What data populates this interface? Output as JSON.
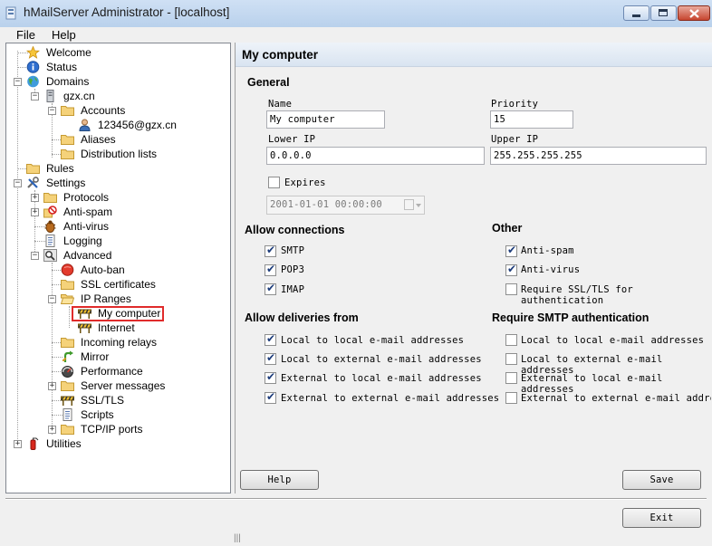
{
  "window": {
    "title": "hMailServer Administrator - [localhost]"
  },
  "menu": {
    "file": "File",
    "help": "Help"
  },
  "tree": {
    "welcome": "Welcome",
    "status": "Status",
    "domains": "Domains",
    "domain": "gzx.cn",
    "accounts": "Accounts",
    "account": "123456@gzx.cn",
    "aliases": "Aliases",
    "distribution_lists": "Distribution lists",
    "rules": "Rules",
    "settings": "Settings",
    "protocols": "Protocols",
    "anti_spam": "Anti-spam",
    "anti_virus": "Anti-virus",
    "logging": "Logging",
    "advanced": "Advanced",
    "auto_ban": "Auto-ban",
    "ssl_certificates": "SSL certificates",
    "ip_ranges": "IP Ranges",
    "my_computer": "My computer",
    "internet": "Internet",
    "incoming_relays": "Incoming relays",
    "mirror": "Mirror",
    "performance": "Performance",
    "server_messages": "Server messages",
    "ssl_tls": "SSL/TLS",
    "scripts": "Scripts",
    "tcpip_ports": "TCP/IP ports",
    "utilities": "Utilities"
  },
  "panel": {
    "title": "My computer",
    "general": "General",
    "name_label": "Name",
    "name_value": "My computer",
    "priority_label": "Priority",
    "priority_value": "15",
    "lower_ip_label": "Lower IP",
    "lower_ip_value": "0.0.0.0",
    "upper_ip_label": "Upper IP",
    "upper_ip_value": "255.255.255.255",
    "expires_label": "Expires",
    "expires_value": "2001-01-01 00:00:00",
    "allow_connections": "Allow connections",
    "smtp": "SMTP",
    "pop3": "POP3",
    "imap": "IMAP",
    "other": "Other",
    "anti_spam": "Anti-spam",
    "anti_virus": "Anti-virus",
    "require_ssl": "Require SSL/TLS for authentication",
    "allow_deliveries": "Allow deliveries from",
    "require_smtp_auth": "Require SMTP authentication",
    "local_to_local": "Local to local e-mail addresses",
    "local_to_external": "Local to external e-mail addresses",
    "external_to_local": "External to local e-mail addresses",
    "external_to_external": "External to external e-mail addresses",
    "help_button": "Help",
    "save_button": "Save"
  },
  "exit_button": "Exit"
}
